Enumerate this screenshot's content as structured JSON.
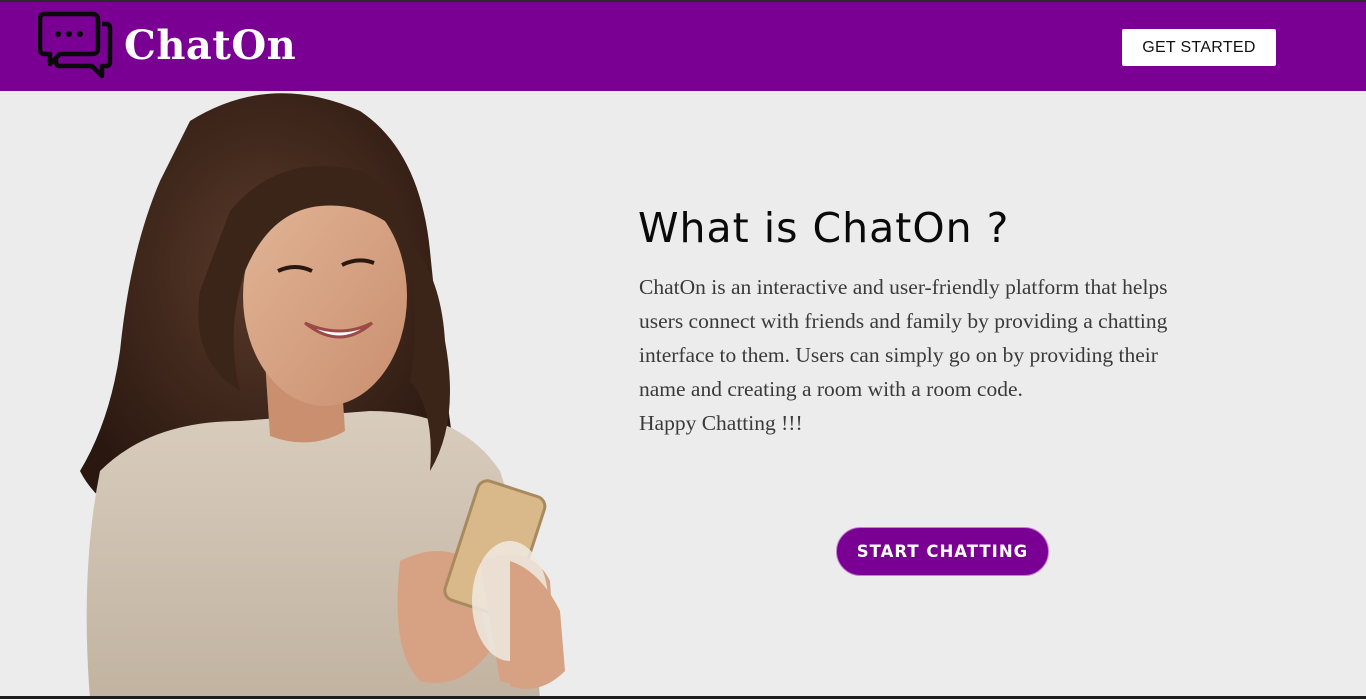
{
  "navbar": {
    "brand": "ChatOn",
    "logo_icon": "chat-bubbles-icon",
    "get_started_label": "GET STARTED",
    "background": "#7a0093"
  },
  "hero": {
    "image": "woman-with-phone-photo",
    "heading": "What is ChatOn ?",
    "description_lines": [
      "ChatOn is an interactive and user-friendly platform that helps",
      "users connect with friends and family by providing a chatting",
      "interface to them. Users can simply go on by providing their",
      "name and creating a room with a room code."
    ],
    "tagline": "Happy Chatting !!!",
    "cta_label": "START CHATTING"
  },
  "colors": {
    "accent": "#7a0093",
    "page_background": "#ececec",
    "text": "#3a3a3a"
  }
}
